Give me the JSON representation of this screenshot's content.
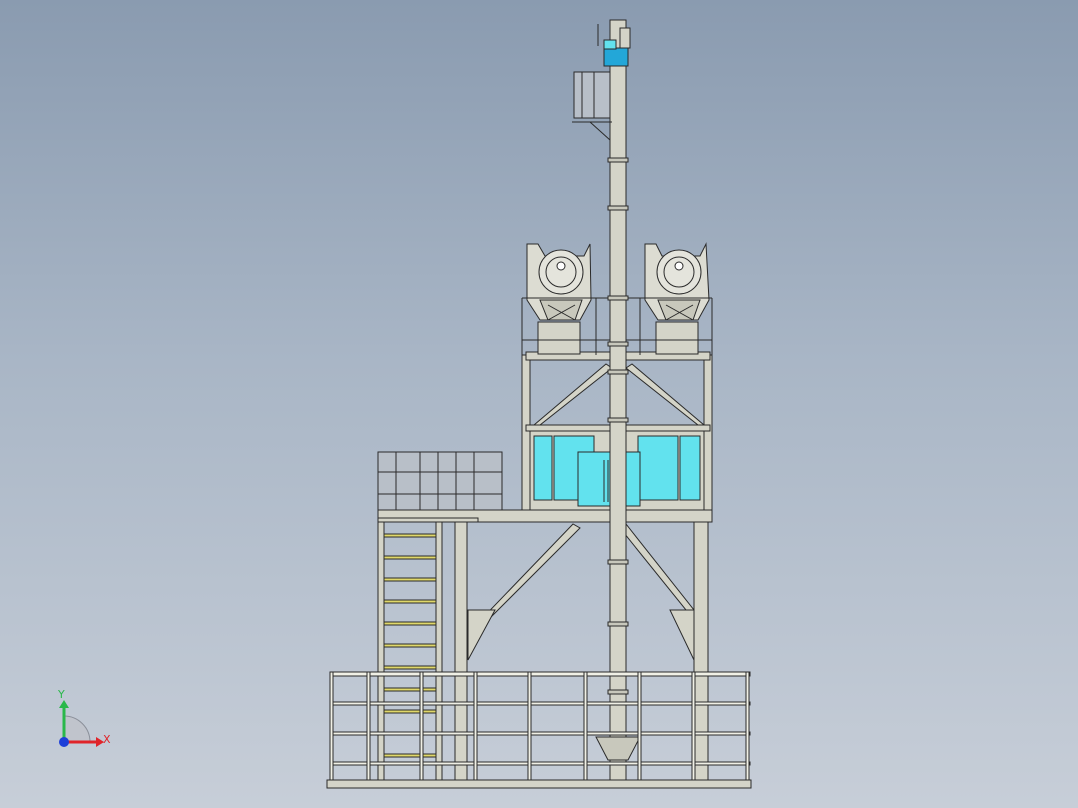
{
  "viewport": {
    "background_top": "#8a9bb0",
    "background_bottom": "#c7ced8"
  },
  "colors": {
    "structure_fill": "#d4d4c8",
    "structure_stroke": "#2a2a2a",
    "equipment_fill": "#dcdcd2",
    "glazing": "#62e2ee",
    "motor": "#23a7d8",
    "stair_tread": "#e0d86a",
    "railing": "#f0f0e6",
    "axis_x": "#e0242a",
    "axis_y": "#29b84a",
    "axis_z": "#1d3fd8"
  },
  "triad": {
    "x_label": "X",
    "y_label": "Y"
  },
  "model": {
    "components": [
      "elevator-shaft",
      "drive-motor",
      "top-service-platform",
      "mixer-left",
      "mixer-right",
      "cabin-glazing",
      "main-deck",
      "stair-flight",
      "perimeter-railing",
      "base-frame"
    ]
  }
}
